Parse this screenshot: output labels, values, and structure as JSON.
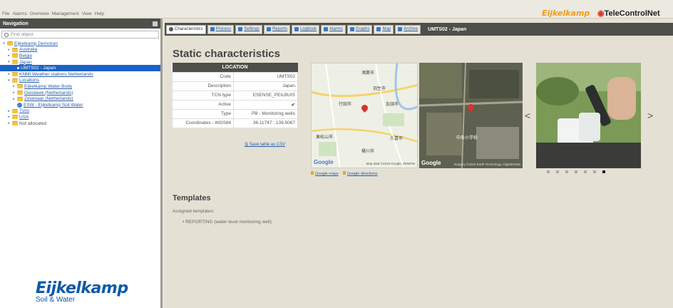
{
  "menu": [
    "File",
    "Alarms",
    "Overview",
    "Management",
    "View",
    "Help"
  ],
  "brand": {
    "primary": "Eijkelkamp",
    "secondary": "TeleControlNet"
  },
  "nav": {
    "title": "Navigation",
    "search_placeholder": "Find object",
    "tree": [
      {
        "label": "Eijkelkamp Demotuin",
        "depth": 0,
        "toggle": "▾",
        "kind": "folder"
      },
      {
        "label": "Australia",
        "depth": 1,
        "toggle": "▸",
        "kind": "folder"
      },
      {
        "label": "Belgie",
        "depth": 1,
        "toggle": "▸",
        "kind": "folder"
      },
      {
        "label": "Japan",
        "depth": 1,
        "toggle": "▾",
        "kind": "folder"
      },
      {
        "label": "UMTS02 - Japan",
        "depth": 2,
        "toggle": "",
        "kind": "selected"
      },
      {
        "label": "KNMI Weather stations Netherlands",
        "depth": 1,
        "toggle": "▸",
        "kind": "folder"
      },
      {
        "label": "Locations",
        "depth": 1,
        "toggle": "▾",
        "kind": "folder"
      },
      {
        "label": "Eijkelkamp Water Body",
        "depth": 2,
        "toggle": "▸",
        "kind": "folder"
      },
      {
        "label": "Giesbeek (Netherlands)",
        "depth": 2,
        "toggle": "▸",
        "kind": "folder"
      },
      {
        "label": "Zevenaar (Netherlands)",
        "depth": 2,
        "toggle": "▸",
        "kind": "folder"
      },
      {
        "label": "ESW - Eijkelkamp Soil Water",
        "depth": 2,
        "toggle": "",
        "kind": "globe"
      },
      {
        "label": "Tvos",
        "depth": 1,
        "toggle": "▸",
        "kind": "folder"
      },
      {
        "label": "USA",
        "depth": 1,
        "toggle": "▸",
        "kind": "folder"
      },
      {
        "label": "Not allocated",
        "depth": 1,
        "toggle": "▸",
        "kind": "plain"
      }
    ],
    "logo_line1": "Eijkelkamp",
    "logo_line2": "Soil & Water"
  },
  "tabs": [
    {
      "label": "Characteristics",
      "active": true
    },
    {
      "label": "Process",
      "active": false
    },
    {
      "label": "Settings",
      "active": false
    },
    {
      "label": "Reports",
      "active": false
    },
    {
      "label": "Logbook",
      "active": false
    },
    {
      "label": "Alarms",
      "active": false
    },
    {
      "label": "Graphs",
      "active": false
    },
    {
      "label": "Map",
      "active": false
    },
    {
      "label": "Archive",
      "active": false
    }
  ],
  "tab_title": "UMTS02 - Japan",
  "page": {
    "title": "Static characteristics",
    "location_header": "LOCATION",
    "rows": [
      {
        "key": "Code",
        "value": "UMTS02"
      },
      {
        "key": "Description",
        "value": "Japan"
      },
      {
        "key": "TCN type",
        "value": "ESENSE_PEILBUIS"
      },
      {
        "key": "Active",
        "value": "✔"
      },
      {
        "key": "Type",
        "value": "PB - Monitoring wells"
      },
      {
        "key": "Coordinates - WGS84",
        "value": "36.11747 ; 139.5067"
      }
    ],
    "save_csv": "Save table as CSV",
    "map_google": "Google",
    "map_attr": "Map data ©2018 Google, ZENRIN",
    "sat_attr": "Imagery ©2018 Earth Technology, DigitalGlobe",
    "map_labels": [
      "鴻巣市",
      "羽生市",
      "行田市",
      "加須市",
      "東松山市",
      "久喜市",
      "桶川市"
    ],
    "sat_labels": [
      "中条小学校"
    ],
    "map_link": "Google maps",
    "directions_link": "Google directions",
    "carousel_prev": "<",
    "carousel_next": ">",
    "carousel_count": 7,
    "carousel_active": 6,
    "templates_title": "Templates",
    "assigned_label": "Assigned templates:",
    "template_item": "• REPORTING (water level monitoring well)"
  }
}
